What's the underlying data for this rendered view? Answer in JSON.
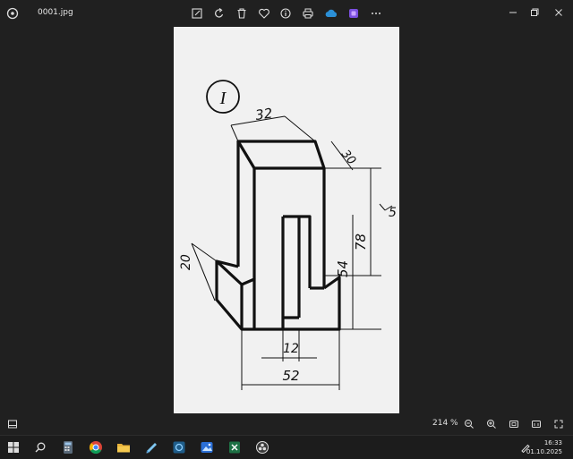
{
  "window": {
    "filename": "0001.jpg"
  },
  "toolbar": {
    "icons": [
      "edit-icon",
      "rotate-icon",
      "delete-icon",
      "favorite-icon",
      "info-icon",
      "print-icon",
      "cloud-icon",
      "clipchamp-icon",
      "more-icon"
    ]
  },
  "drawing": {
    "badge": "I",
    "dims": {
      "d32": "32",
      "d30": "30",
      "d5": "5",
      "d78": "78",
      "d54": "54",
      "d20": "20",
      "d12": "12",
      "d52": "52"
    }
  },
  "status": {
    "zoom": "214 %"
  },
  "taskbar": {
    "time": "16:33",
    "date": "01.10.2025"
  },
  "colors": {
    "background": "#202020",
    "paper": "#f1f1f1",
    "accent": "#2b8fd6"
  }
}
